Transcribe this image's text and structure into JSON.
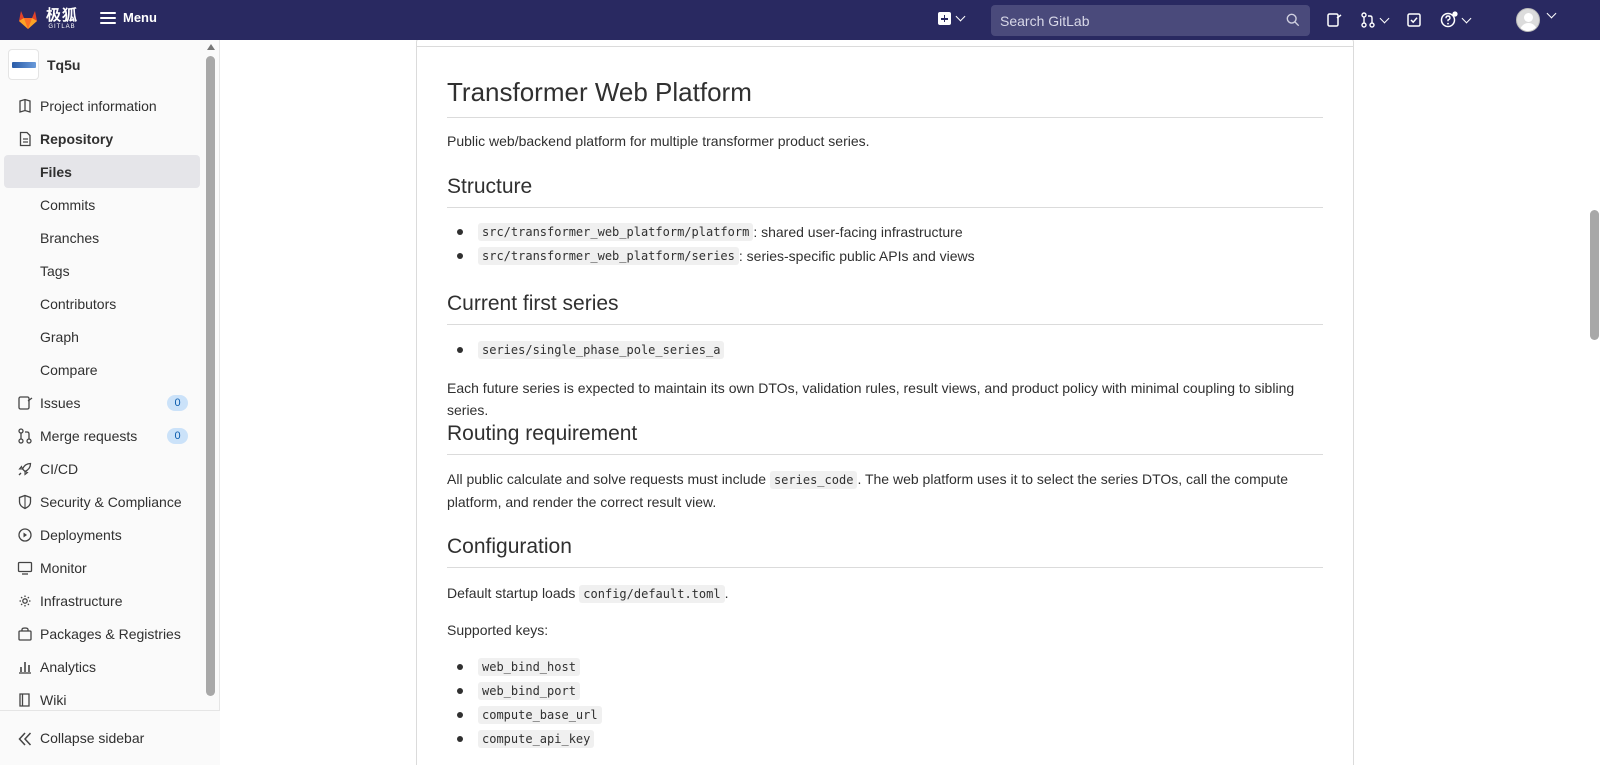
{
  "topbar": {
    "brand_big": "极狐",
    "brand_small": "GITLAB",
    "menu_label": "Menu",
    "search_placeholder": "Search GitLab"
  },
  "sidebar": {
    "project_name": "Tq5u",
    "items": [
      {
        "label": "Project information"
      },
      {
        "label": "Repository"
      },
      {
        "label": "Files"
      },
      {
        "label": "Commits"
      },
      {
        "label": "Branches"
      },
      {
        "label": "Tags"
      },
      {
        "label": "Contributors"
      },
      {
        "label": "Graph"
      },
      {
        "label": "Compare"
      },
      {
        "label": "Issues",
        "badge": "0"
      },
      {
        "label": "Merge requests",
        "badge": "0"
      },
      {
        "label": "CI/CD"
      },
      {
        "label": "Security & Compliance"
      },
      {
        "label": "Deployments"
      },
      {
        "label": "Monitor"
      },
      {
        "label": "Infrastructure"
      },
      {
        "label": "Packages & Registries"
      },
      {
        "label": "Analytics"
      },
      {
        "label": "Wiki"
      }
    ],
    "collapse_label": "Collapse sidebar"
  },
  "readme": {
    "title": "Transformer Web Platform",
    "intro": "Public web/backend platform for multiple transformer product series.",
    "structure": {
      "heading": "Structure",
      "items": [
        {
          "code": "src/transformer_web_platform/platform",
          "text": ": shared user-facing infrastructure"
        },
        {
          "code": "src/transformer_web_platform/series",
          "text": ": series-specific public APIs and views"
        }
      ]
    },
    "first_series": {
      "heading": "Current first series",
      "item": "series/single_phase_pole_series_a",
      "note": "Each future series is expected to maintain its own DTOs, validation rules, result views, and product policy with minimal coupling to sibling series."
    },
    "routing": {
      "heading": "Routing requirement",
      "text_before": "All public calculate and solve requests must include ",
      "code": "series_code",
      "text_after": ". The web platform uses it to select the series DTOs, call the compute platform, and render the correct result view."
    },
    "configuration": {
      "heading": "Configuration",
      "text_before": "Default startup loads ",
      "code": "config/default.toml",
      "text_after": ".",
      "keys_label": "Supported keys:",
      "keys": [
        "web_bind_host",
        "web_bind_port",
        "compute_base_url",
        "compute_api_key"
      ]
    }
  }
}
